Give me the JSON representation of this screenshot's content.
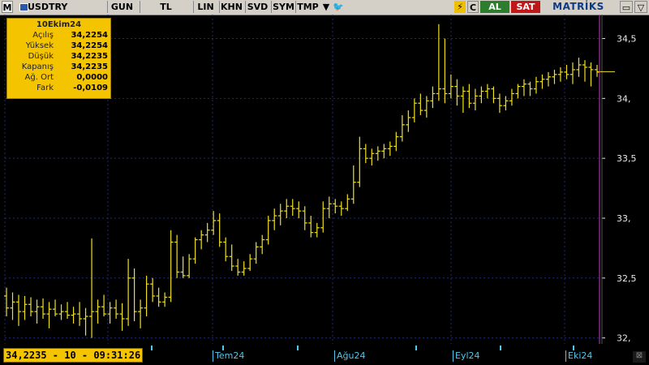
{
  "toolbar": {
    "m_label": "M",
    "symbol": "USDTRY",
    "period": "GUN",
    "currency": "TL",
    "lin": "LIN",
    "khn": "KHN",
    "svd": "SVD",
    "sym": "SYM",
    "tmp": "TMP",
    "dropdown_icon": "▼",
    "twitter_icon": "🐦",
    "bolt_icon": "⚡",
    "c_label": "C",
    "buy": "AL",
    "sell": "SAT",
    "brand": "MATRİKS",
    "win_btn1": "▭",
    "win_btn2": "▽"
  },
  "info_box": {
    "date": "10Ekim24",
    "rows": [
      {
        "label": "Açılış",
        "value": "34,2254"
      },
      {
        "label": "Yüksek",
        "value": "34,2254"
      },
      {
        "label": "Düşük",
        "value": "34,2235"
      },
      {
        "label": "Kapanış",
        "value": "34,2235"
      },
      {
        "label": "Ağ. Ort",
        "value": "0,0000"
      },
      {
        "label": "Fark",
        "value": "-0,0109"
      }
    ]
  },
  "readout": "34,2235 - 10 - 09:31:26",
  "corner_icon": "⊠",
  "colors": {
    "background": "#000000",
    "bars": "#f0e020",
    "grid": "#1e2a7a",
    "axis_text": "#e8e8e8",
    "cursor_line": "#c040c0",
    "month_label": "#50c8f0"
  },
  "chart_data": {
    "type": "ohlc",
    "symbol": "USDTRY",
    "x_ticks": [
      "Tem24",
      "Ağu24",
      "Eyl24",
      "Eki24"
    ],
    "y_ticks": [
      "34,5",
      "34,",
      "33,5",
      "33,",
      "32,5",
      "32,"
    ],
    "ylim": [
      31.95,
      34.7
    ],
    "grid": true,
    "last_value": 34.2235,
    "bars": [
      [
        32.35,
        32.42,
        32.18,
        32.25
      ],
      [
        32.25,
        32.38,
        32.15,
        32.3
      ],
      [
        32.3,
        32.36,
        32.1,
        32.22
      ],
      [
        32.22,
        32.35,
        32.15,
        32.28
      ],
      [
        32.28,
        32.34,
        32.18,
        32.22
      ],
      [
        32.22,
        32.32,
        32.12,
        32.26
      ],
      [
        32.26,
        32.33,
        32.16,
        32.2
      ],
      [
        32.2,
        32.3,
        32.08,
        32.24
      ],
      [
        32.24,
        32.32,
        32.18,
        32.2
      ],
      [
        32.2,
        32.28,
        32.15,
        32.22
      ],
      [
        32.22,
        32.3,
        32.16,
        32.19
      ],
      [
        32.19,
        32.26,
        32.12,
        32.2
      ],
      [
        32.2,
        32.3,
        32.1,
        32.16
      ],
      [
        32.16,
        32.25,
        32.02,
        32.18
      ],
      [
        32.18,
        32.83,
        32.0,
        32.22
      ],
      [
        32.22,
        32.32,
        32.12,
        32.26
      ],
      [
        32.26,
        32.36,
        32.18,
        32.2
      ],
      [
        32.2,
        32.3,
        32.12,
        32.25
      ],
      [
        32.25,
        32.32,
        32.16,
        32.2
      ],
      [
        32.2,
        32.29,
        32.06,
        32.16
      ],
      [
        32.16,
        32.66,
        32.1,
        32.5
      ],
      [
        32.5,
        32.58,
        32.14,
        32.22
      ],
      [
        32.22,
        32.32,
        32.08,
        32.25
      ],
      [
        32.25,
        32.52,
        32.18,
        32.45
      ],
      [
        32.45,
        32.5,
        32.3,
        32.35
      ],
      [
        32.35,
        32.42,
        32.26,
        32.3
      ],
      [
        32.3,
        32.38,
        32.26,
        32.34
      ],
      [
        32.34,
        32.9,
        32.3,
        32.8
      ],
      [
        32.8,
        32.86,
        32.5,
        32.55
      ],
      [
        32.55,
        32.68,
        32.5,
        32.52
      ],
      [
        32.52,
        32.7,
        32.5,
        32.66
      ],
      [
        32.66,
        32.84,
        32.62,
        32.82
      ],
      [
        32.82,
        32.9,
        32.74,
        32.86
      ],
      [
        32.86,
        32.96,
        32.8,
        32.9
      ],
      [
        32.9,
        33.06,
        32.86,
        32.98
      ],
      [
        32.98,
        33.04,
        32.76,
        32.8
      ],
      [
        32.8,
        32.84,
        32.64,
        32.68
      ],
      [
        32.68,
        32.78,
        32.56,
        32.6
      ],
      [
        32.6,
        32.66,
        32.52,
        32.55
      ],
      [
        32.55,
        32.64,
        32.52,
        32.58
      ],
      [
        32.58,
        32.7,
        32.56,
        32.66
      ],
      [
        32.66,
        32.8,
        32.62,
        32.76
      ],
      [
        32.76,
        32.86,
        32.7,
        32.82
      ],
      [
        32.82,
        33.02,
        32.78,
        32.98
      ],
      [
        32.98,
        33.08,
        32.9,
        33.02
      ],
      [
        33.02,
        33.12,
        32.94,
        33.06
      ],
      [
        33.06,
        33.16,
        33.0,
        33.1
      ],
      [
        33.1,
        33.16,
        33.02,
        33.08
      ],
      [
        33.08,
        33.14,
        33.0,
        33.06
      ],
      [
        33.06,
        33.1,
        32.9,
        32.96
      ],
      [
        32.96,
        33.02,
        32.84,
        32.88
      ],
      [
        32.88,
        32.96,
        32.84,
        32.92
      ],
      [
        32.92,
        33.14,
        32.88,
        33.08
      ],
      [
        33.08,
        33.18,
        33.0,
        33.12
      ],
      [
        33.12,
        33.16,
        33.04,
        33.1
      ],
      [
        33.1,
        33.14,
        33.02,
        33.08
      ],
      [
        33.08,
        33.2,
        33.06,
        33.16
      ],
      [
        33.16,
        33.44,
        33.12,
        33.3
      ],
      [
        33.3,
        33.68,
        33.26,
        33.58
      ],
      [
        33.58,
        33.62,
        33.46,
        33.5
      ],
      [
        33.5,
        33.58,
        33.44,
        33.54
      ],
      [
        33.54,
        33.6,
        33.48,
        33.56
      ],
      [
        33.56,
        33.62,
        33.5,
        33.58
      ],
      [
        33.58,
        33.64,
        33.52,
        33.6
      ],
      [
        33.6,
        33.72,
        33.56,
        33.68
      ],
      [
        33.68,
        33.86,
        33.64,
        33.78
      ],
      [
        33.78,
        33.9,
        33.72,
        33.84
      ],
      [
        33.84,
        34.0,
        33.8,
        33.96
      ],
      [
        33.96,
        34.04,
        33.86,
        33.9
      ],
      [
        33.9,
        34.02,
        33.84,
        33.98
      ],
      [
        33.98,
        34.1,
        33.92,
        34.04
      ],
      [
        34.04,
        34.62,
        33.98,
        34.08
      ],
      [
        34.08,
        34.5,
        33.96,
        34.04
      ],
      [
        34.04,
        34.2,
        34.0,
        34.1
      ],
      [
        34.1,
        34.16,
        33.94,
        34.02
      ],
      [
        34.02,
        34.1,
        33.88,
        34.06
      ],
      [
        34.06,
        34.12,
        33.92,
        33.96
      ],
      [
        33.96,
        34.08,
        33.9,
        34.02
      ],
      [
        34.02,
        34.1,
        33.96,
        34.06
      ],
      [
        34.06,
        34.12,
        34.0,
        34.08
      ],
      [
        34.08,
        34.1,
        33.96,
        34.0
      ],
      [
        34.0,
        34.04,
        33.88,
        33.94
      ],
      [
        33.94,
        34.02,
        33.9,
        33.98
      ],
      [
        33.98,
        34.08,
        33.94,
        34.04
      ],
      [
        34.04,
        34.12,
        34.0,
        34.1
      ],
      [
        34.1,
        34.16,
        34.02,
        34.12
      ],
      [
        34.12,
        34.14,
        34.02,
        34.08
      ],
      [
        34.08,
        34.18,
        34.04,
        34.14
      ],
      [
        34.14,
        34.2,
        34.08,
        34.16
      ],
      [
        34.16,
        34.22,
        34.1,
        34.18
      ],
      [
        34.18,
        34.24,
        34.12,
        34.2
      ],
      [
        34.2,
        34.26,
        34.14,
        34.22
      ],
      [
        34.22,
        34.28,
        34.16,
        34.2
      ],
      [
        34.2,
        34.3,
        34.12,
        34.24
      ],
      [
        34.24,
        34.34,
        34.18,
        34.28
      ],
      [
        34.28,
        34.32,
        34.14,
        34.26
      ],
      [
        34.26,
        34.3,
        34.1,
        34.24
      ],
      [
        34.24,
        34.28,
        34.18,
        34.22
      ]
    ]
  }
}
